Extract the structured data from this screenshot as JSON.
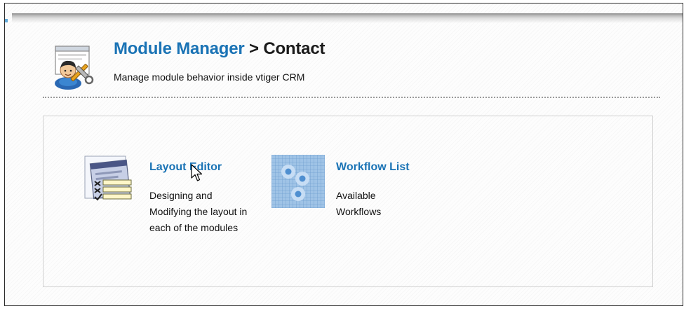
{
  "header": {
    "breadcrumb_parent": "Module Manager",
    "breadcrumb_separator": ">",
    "breadcrumb_current": "Contact",
    "subtitle": "Manage module behavior inside vtiger CRM",
    "icon": "module-manager-icon"
  },
  "options": [
    {
      "title": "Layout Editor",
      "description": "Designing and Modifying the layout in each of the modules",
      "icon": "layout-editor-icon"
    },
    {
      "title": "Workflow List",
      "description": "Available Workflows",
      "icon": "workflow-list-icon"
    }
  ],
  "colors": {
    "link": "#1a73b5",
    "text": "#111111",
    "panel_border": "#cfcfcf"
  }
}
